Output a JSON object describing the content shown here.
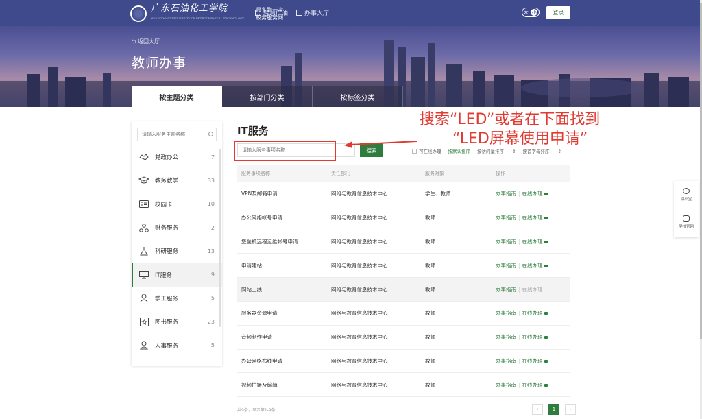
{
  "header": {
    "logo_text": "广东石油化工学院",
    "logo_sub": "GUANGDONG UNIVERSITY OF PETROCHEMICAL TECHNOLOGY",
    "motto_line1": "最多跑一次",
    "motto_line2": "校务服务网",
    "nav": [
      {
        "label": "智慧广油",
        "icon": "building-icon"
      },
      {
        "label": "办事大厅",
        "icon": "hall-icon"
      }
    ],
    "font_toggle_big": "大",
    "font_toggle_small": "小",
    "login_label": "登录"
  },
  "banner": {
    "back_label": "返回大厅",
    "title": "教师办事",
    "tabs": [
      {
        "label": "按主题分类",
        "active": true
      },
      {
        "label": "按部门分类",
        "active": false
      },
      {
        "label": "按标签分类",
        "active": false
      }
    ]
  },
  "sidebar": {
    "search_placeholder": "请输入服务主题名称",
    "items": [
      {
        "label": "党政办公",
        "count": "7",
        "icon": "handshake-icon"
      },
      {
        "label": "教务教学",
        "count": "33",
        "icon": "graduation-cap-icon"
      },
      {
        "label": "校园卡",
        "count": "10",
        "icon": "id-card-icon"
      },
      {
        "label": "财务服务",
        "count": "2",
        "icon": "finance-icon"
      },
      {
        "label": "科研服务",
        "count": "13",
        "icon": "flask-icon"
      },
      {
        "label": "IT服务",
        "count": "9",
        "icon": "monitor-icon",
        "active": true
      },
      {
        "label": "学工服务",
        "count": "5",
        "icon": "student-icon"
      },
      {
        "label": "图书服务",
        "count": "23",
        "icon": "book-icon"
      },
      {
        "label": "人事服务",
        "count": "5",
        "icon": "person-icon"
      }
    ]
  },
  "main": {
    "title": "IT服务",
    "search_placeholder": "请输入服务事项名称",
    "search_button": "搜索",
    "filters": {
      "online_only": "可在线办理",
      "sort_default": "按默认排序",
      "sort_visits": "按访问量排序",
      "sort_alpha": "按首字母排序"
    },
    "columns": [
      "服务事项名称",
      "责任部门",
      "服务对象",
      "操作"
    ],
    "rows": [
      {
        "name": "VPN及邮箱申请",
        "dept": "网络与教育信息技术中心",
        "target": "学生、教师",
        "guide": "办事指南",
        "online": "在线办理",
        "online_enabled": true
      },
      {
        "name": "办公网络帐号申请",
        "dept": "网络与教育信息技术中心",
        "target": "教师",
        "guide": "办事指南",
        "online": "在线办理",
        "online_enabled": true
      },
      {
        "name": "堡垒机远程运维帐号申请",
        "dept": "网络与教育信息技术中心",
        "target": "教师",
        "guide": "办事指南",
        "online": "在线办理",
        "online_enabled": true
      },
      {
        "name": "申请建站",
        "dept": "网络与教育信息技术中心",
        "target": "教师",
        "guide": "办事指南",
        "online": "在线办理",
        "online_enabled": true
      },
      {
        "name": "网站上线",
        "dept": "网络与教育信息技术中心",
        "target": "教师",
        "guide": "办事指南",
        "online": "在线办理",
        "online_enabled": false
      },
      {
        "name": "服务器资源申请",
        "dept": "网络与教育信息技术中心",
        "target": "教师",
        "guide": "办事指南",
        "online": "在线办理",
        "online_enabled": true
      },
      {
        "name": "音频制作申请",
        "dept": "网络与教育信息技术中心",
        "target": "教师",
        "guide": "办事指南",
        "online": "在线办理",
        "online_enabled": true
      },
      {
        "name": "办公网络布线申请",
        "dept": "网络与教育信息技术中心",
        "target": "教师",
        "guide": "办事指南",
        "online": "在线办理",
        "online_enabled": true
      },
      {
        "name": "视频拍摄及编辑",
        "dept": "网络与教育信息技术中心",
        "target": "教师",
        "guide": "办事指南",
        "online": "在线办理",
        "online_enabled": true
      }
    ],
    "pager_info": "共9条，显示第1-9条",
    "pager": {
      "prev": "‹",
      "current": "1",
      "next": "›"
    }
  },
  "annotation": {
    "line1": "搜索“LED”或者在下面找到",
    "line2": "“LED屏幕使用申请”",
    "color": "#e03a31"
  },
  "float_panel": [
    {
      "label": "油小宝",
      "icon": "chatbot-icon"
    },
    {
      "label": "学校官网",
      "icon": "monitor-icon"
    }
  ],
  "colors": {
    "header": "#3e4a8c",
    "accent": "#2e7d3e"
  }
}
